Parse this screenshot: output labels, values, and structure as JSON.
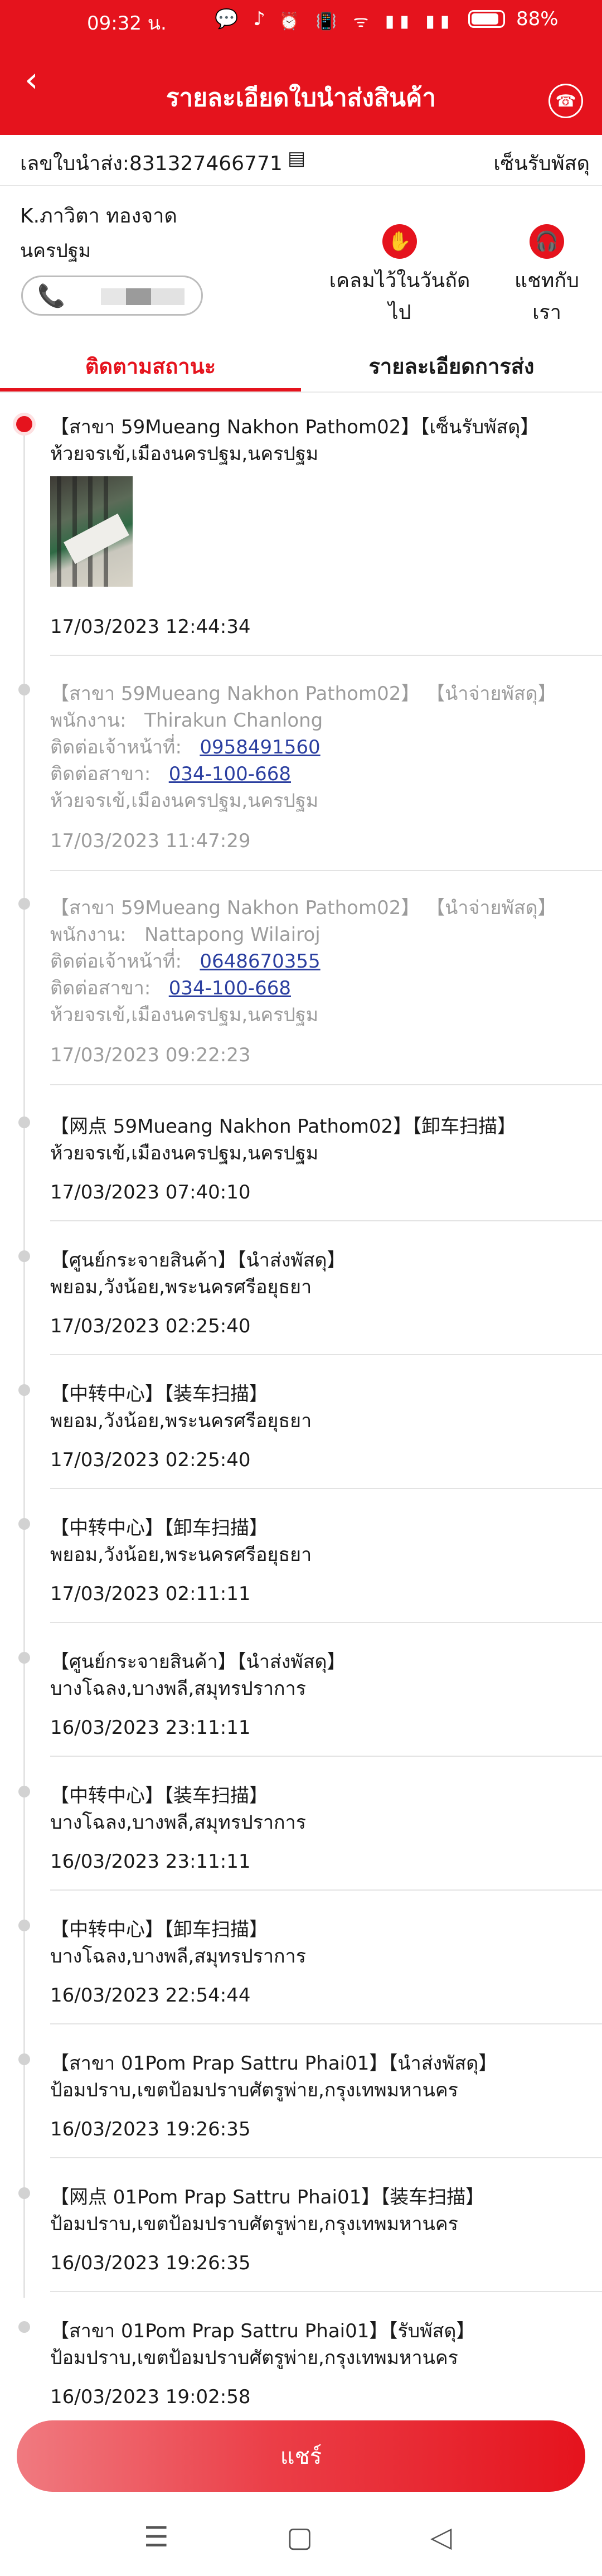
{
  "status_bar": {
    "time": "09:32 น.",
    "left_icons": "💬 ♪ •",
    "right_icons": "⏰ 📳 ᯤ ▮▮ ▮▮",
    "battery_percent": 88,
    "battery_text": "88%"
  },
  "header": {
    "title": "รายละเอียดใบนำส่งสินค้า",
    "back_icon": "‹",
    "service_icon": "☎"
  },
  "waybill": {
    "label": "เลขใบนำส่ง:831327466771",
    "copy_icon": "▤",
    "status": "เซ็นรับพัสดุ"
  },
  "receiver": {
    "name": "K.ภาวิตา ทองจาด",
    "province": "นครปฐม",
    "phone_icon": "📞"
  },
  "actions": {
    "claim_label": "เคลมไว้ในวันถัดไป",
    "claim_icon": "✋",
    "chat_label": "แชทกับเรา",
    "chat_icon": "🎧"
  },
  "tabs": [
    {
      "label": "ติดตามสถานะ",
      "active": true
    },
    {
      "label": "รายละเอียดการส่ง",
      "active": false
    }
  ],
  "timeline": [
    {
      "line1": "【สาขา 59Mueang Nakhon Pathom02】【เซ็นรับพัสดุ】",
      "line2": "ห้วยจรเข้,เมืองนครปฐม,นครปฐม",
      "time": "17/03/2023 12:44:34"
    },
    {
      "line1": "【สาขา 59Mueang Nakhon Pathom02】 【นำจ่ายพัสดุ】",
      "staff_label": "พนักงาน:",
      "staff": "Thirakun Chanlong",
      "staff_phone_label": "ติดต่อเจ้าหน้าที่:",
      "staff_phone": "0958491560",
      "branch_phone_label": "ติดต่อสาขา:",
      "branch_phone": "034-100-668",
      "line2": "ห้วยจรเข้,เมืองนครปฐม,นครปฐม",
      "time": "17/03/2023 11:47:29"
    },
    {
      "line1": "【สาขา 59Mueang Nakhon Pathom02】 【นำจ่ายพัสดุ】",
      "staff_label": "พนักงาน:",
      "staff": "Nattapong Wilairoj",
      "staff_phone_label": "ติดต่อเจ้าหน้าที่:",
      "staff_phone": "0648670355",
      "branch_phone_label": "ติดต่อสาขา:",
      "branch_phone": "034-100-668",
      "line2": "ห้วยจรเข้,เมืองนครปฐม,นครปฐม",
      "time": "17/03/2023 09:22:23"
    },
    {
      "line1": "【网点 59Mueang Nakhon Pathom02】【卸车扫描】",
      "line2": "ห้วยจรเข้,เมืองนครปฐม,นครปฐม",
      "time": "17/03/2023 07:40:10"
    },
    {
      "line1": "【ศูนย์กระจายสินค้า】【นำส่งพัสดุ】",
      "line2": "พยอม,วังน้อย,พระนครศรีอยุธยา",
      "time": "17/03/2023 02:25:40"
    },
    {
      "line1": "【中转中心】【装车扫描】",
      "line2": "พยอม,วังน้อย,พระนครศรีอยุธยา",
      "time": "17/03/2023 02:25:40"
    },
    {
      "line1": "【中转中心】【卸车扫描】",
      "line2": "พยอม,วังน้อย,พระนครศรีอยุธยา",
      "time": "17/03/2023 02:11:11"
    },
    {
      "line1": "【ศูนย์กระจายสินค้า】【นำส่งพัสดุ】",
      "line2": "บางโฉลง,บางพลี,สมุทรปราการ",
      "time": "16/03/2023 23:11:11"
    },
    {
      "line1": "【中转中心】【装车扫描】",
      "line2": "บางโฉลง,บางพลี,สมุทรปราการ",
      "time": "16/03/2023 23:11:11"
    },
    {
      "line1": "【中转中心】【卸车扫描】",
      "line2": "บางโฉลง,บางพลี,สมุทรปราการ",
      "time": "16/03/2023 22:54:44"
    },
    {
      "line1": "【สาขา 01Pom Prap Sattru Phai01】【นำส่งพัสดุ】",
      "line2": "ป้อมปราบ,เขตป้อมปราบศัตรูพ่าย,กรุงเทพมหานคร",
      "time": "16/03/2023 19:26:35"
    },
    {
      "line1": "【网点 01Pom Prap Sattru Phai01】【装车扫描】",
      "line2": "ป้อมปราบ,เขตป้อมปราบศัตรูพ่าย,กรุงเทพมหานคร",
      "time": "16/03/2023 19:26:35"
    },
    {
      "line1": "【สาขา 01Pom Prap Sattru Phai01】【รับพัสดุ】",
      "line2": "ป้อมปราบ,เขตป้อมปราบศัตรูพ่าย,กรุงเทพมหานคร",
      "time": "16/03/2023 19:02:58"
    }
  ],
  "share_button": "แชร์",
  "system_nav": {
    "menu_icon": "☰",
    "home_icon": "▢",
    "back_icon": "◁"
  }
}
